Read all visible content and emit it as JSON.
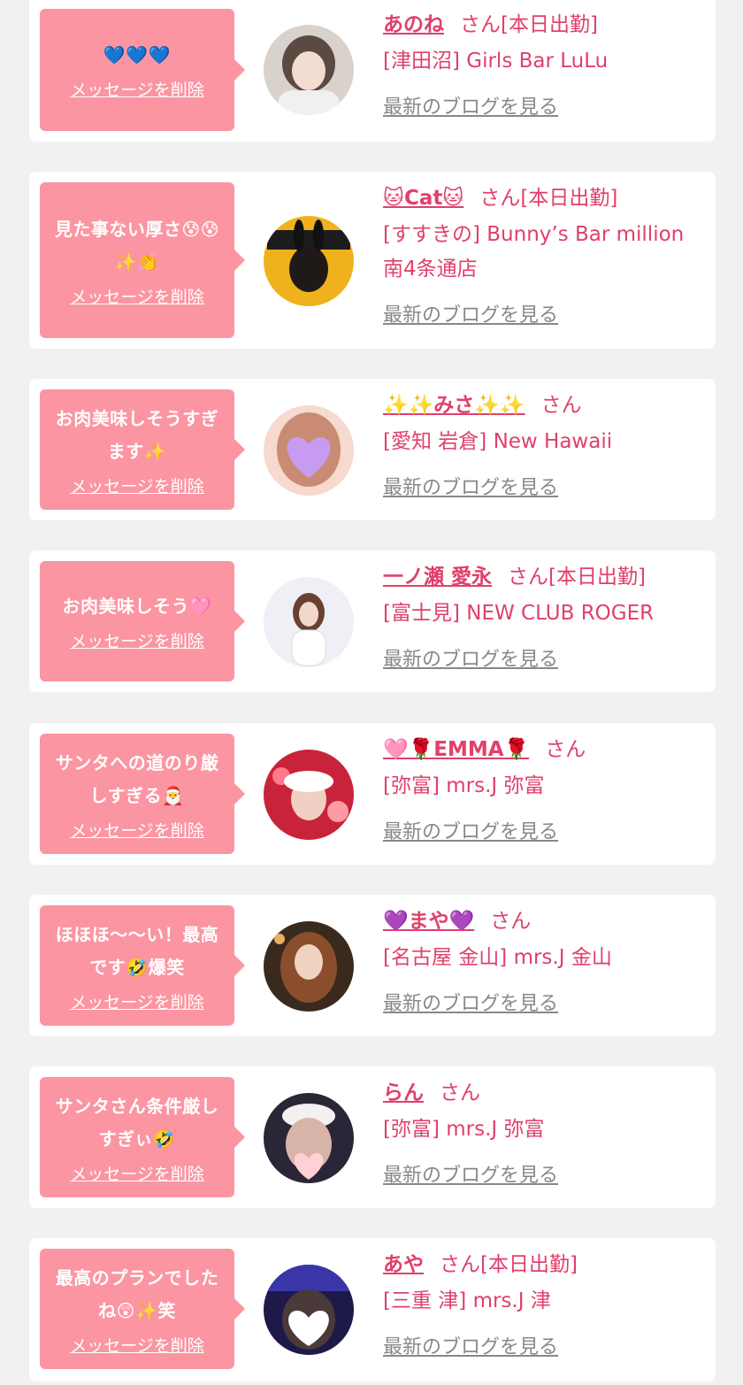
{
  "colors": {
    "accent": "#e0406a",
    "bubble": "#fb95a2",
    "link_gray": "#888888",
    "background": "#f1f1f1"
  },
  "labels": {
    "delete": "メッセージを削除",
    "blog": "最新のブログを見る"
  },
  "items": [
    {
      "message": "💙💙💙",
      "name": "あのね",
      "suffix": "さん[本日出勤]",
      "shop": "[津田沼] Girls Bar LuLu"
    },
    {
      "message": "見た事ない厚さ😰😰✨👏",
      "name": "🐱Cat🐱",
      "suffix": "さん[本日出勤]",
      "shop": "[すすきの] Bunny’s Bar million 南4条通店"
    },
    {
      "message": "お肉美味しそうすぎます✨",
      "name": "✨✨みさ✨✨",
      "suffix": "さん",
      "shop": "[愛知 岩倉] New Hawaii"
    },
    {
      "message": "お肉美味しそう🩷",
      "name": "一ノ瀬 愛永",
      "suffix": "さん[本日出勤]",
      "shop": "[富士見] NEW CLUB ROGER"
    },
    {
      "message": "サンタへの道のり厳しすぎる🎅",
      "name": "🩷🌹EMMA🌹",
      "suffix": "さん",
      "shop": "[弥富] mrs.J 弥富"
    },
    {
      "message": "ほほほ〜〜い！最高です🤣爆笑",
      "name": "💜まや💜",
      "suffix": "さん",
      "shop": "[名古屋 金山] mrs.J 金山"
    },
    {
      "message": "サンタさん条件厳しすぎぃ🤣",
      "name": "らん",
      "suffix": "さん",
      "shop": "[弥富] mrs.J 弥富"
    },
    {
      "message": "最高のプランでしたね😲✨笑",
      "name": "あや",
      "suffix": "さん[本日出勤]",
      "shop": "[三重 津] mrs.J 津"
    }
  ]
}
